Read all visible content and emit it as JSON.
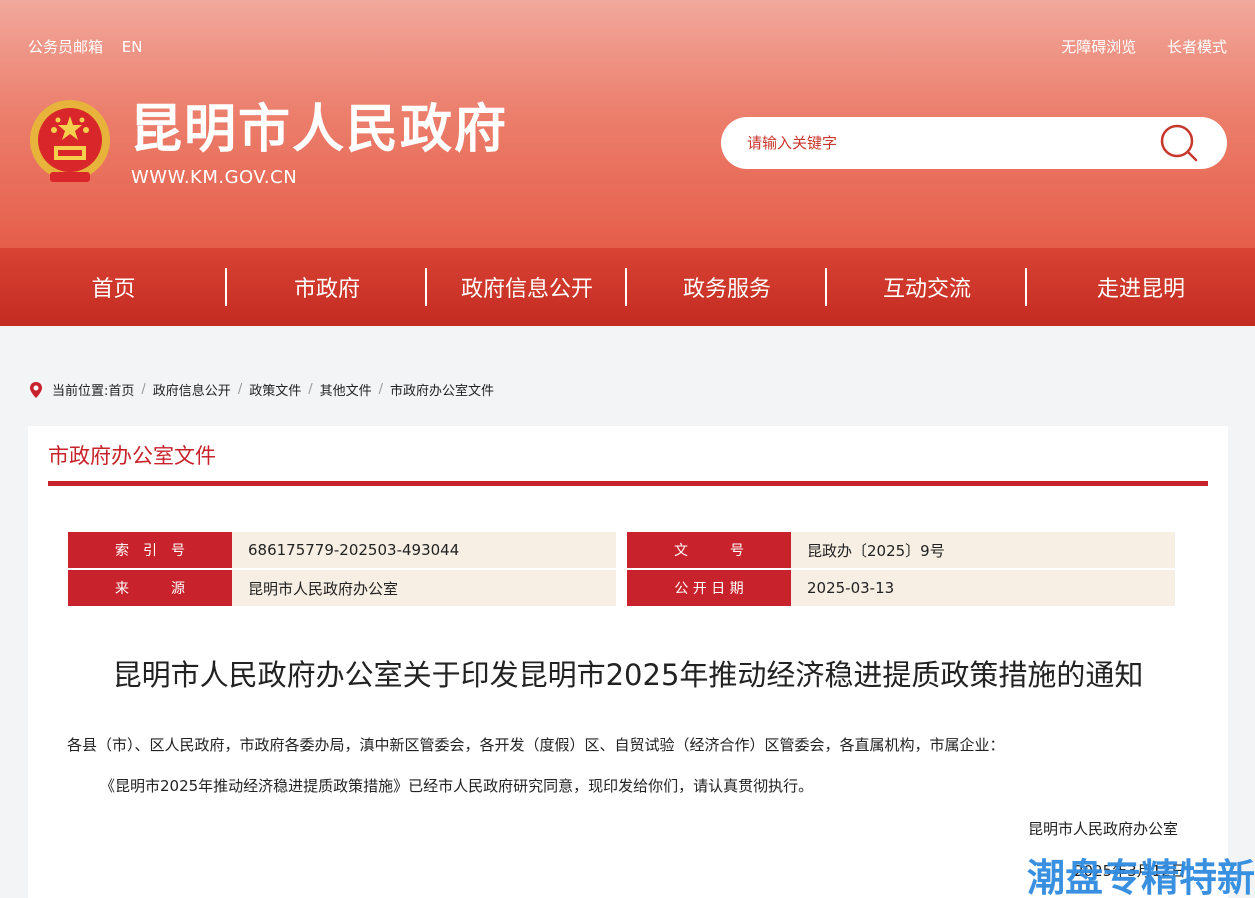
{
  "header": {
    "top_links_left": [
      "公务员邮箱",
      "EN"
    ],
    "top_links_right": [
      "无障碍浏览",
      "长者模式"
    ],
    "site_title": "昆明市人民政府",
    "site_url": "WWW.KM.GOV.CN",
    "search_placeholder": "请输入关键字"
  },
  "nav": {
    "items": [
      "首页",
      "市政府",
      "政府信息公开",
      "政务服务",
      "互动交流",
      "走进昆明"
    ]
  },
  "breadcrumb": {
    "prefix": "当前位置:",
    "items": [
      "首页",
      "政府信息公开",
      "政策文件",
      "其他文件",
      "市政府办公室文件"
    ],
    "separator": "/"
  },
  "panel": {
    "section_title": "市政府办公室文件"
  },
  "meta": {
    "index_label": "索　引　号",
    "index_value": "686175779-202503-493044",
    "docno_label": "文　　　号",
    "docno_value": "昆政办〔2025〕9号",
    "source_label": "来　　　源",
    "source_value": "昆明市人民政府办公室",
    "date_label": "公 开 日 期",
    "date_value": "2025-03-13"
  },
  "document": {
    "title": "昆明市人民政府办公室关于印发昆明市2025年推动经济稳进提质政策措施的通知",
    "recipients": "各县（市）、区人民政府，市政府各委办局，滇中新区管委会，各开发（度假）区、自贸试验（经济合作）区管委会，各直属机构，市属企业：",
    "body": "《昆明市2025年推动经济稳进提质政策措施》已经市人民政府研究同意，现印发给你们，请认真贯彻执行。",
    "signature": "昆明市人民政府办公室",
    "date": "2025年3月12日"
  },
  "watermark": "潮盘专精特新",
  "colors": {
    "brand_red": "#c8232c",
    "meta_bg": "#f7efe3",
    "watermark_blue": "#2f8be0"
  }
}
